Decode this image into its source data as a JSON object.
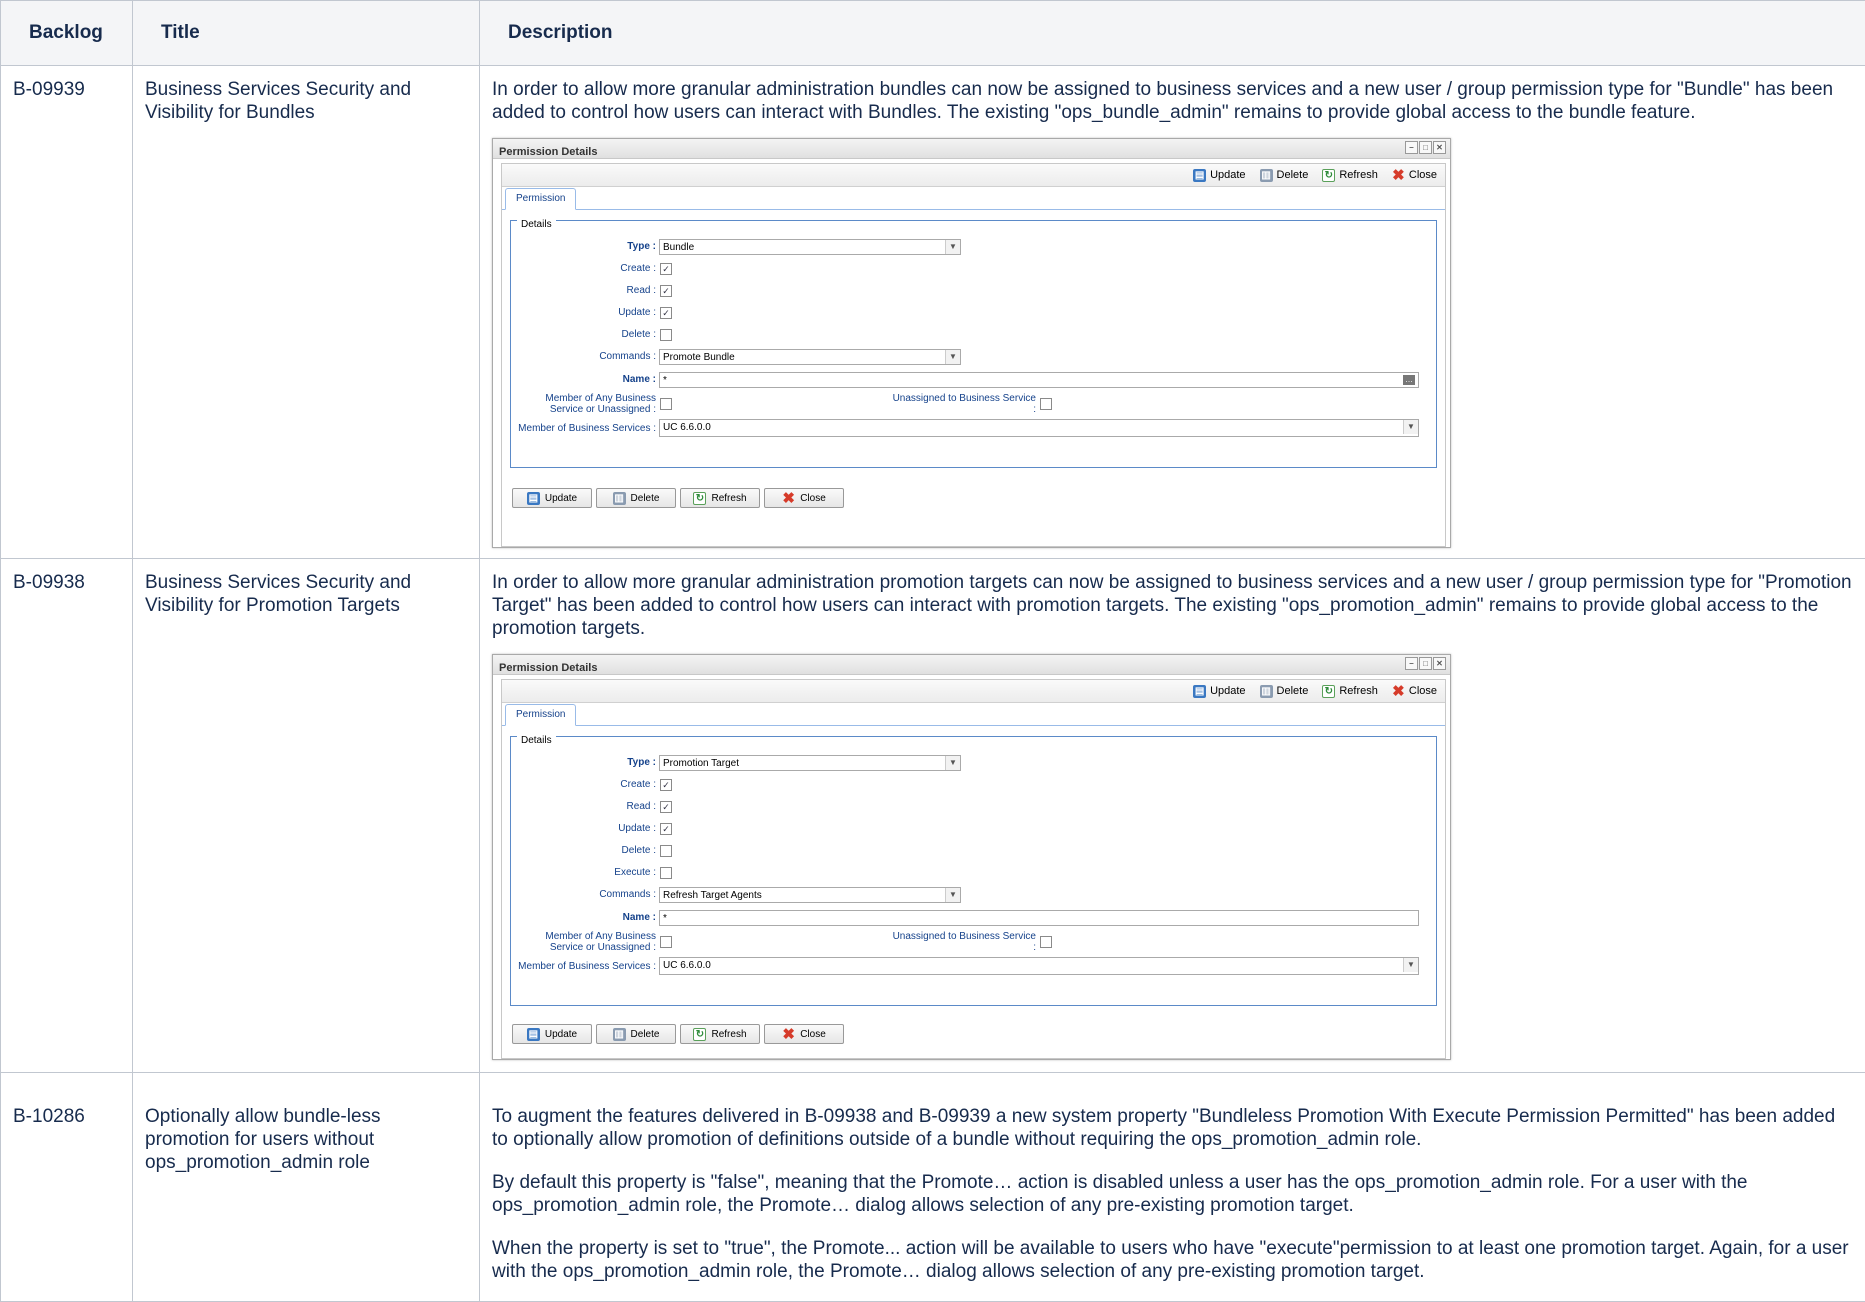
{
  "table": {
    "headers": [
      "Backlog",
      "Title",
      "Description"
    ],
    "rows": [
      {
        "backlog": "B-09939",
        "title": "Business Services Security and Visibility for Bundles",
        "description": [
          "In order to allow more granular administration bundles can now be assigned to business services and a new user / group permission type for \"Bundle\" has been added to control how users can interact with Bundles. The existing \"ops_bundle_admin\" remains to provide global access to the bundle feature."
        ],
        "dialog": {
          "title": "Permission Details",
          "toolbar": [
            "Update",
            "Delete",
            "Refresh",
            "Close"
          ],
          "tab": "Permission",
          "legend": "Details",
          "type_label": "Type :",
          "type_value": "Bundle",
          "create_label": "Create :",
          "read_label": "Read :",
          "update_label": "Update :",
          "delete_label": "Delete :",
          "commands_label": "Commands :",
          "commands_value": "Promote Bundle",
          "name_label": "Name :",
          "name_value": "*",
          "member_any_label": "Member of Any Business Service or Unassigned :",
          "unassigned_label": "Unassigned to Business Service :",
          "member_of_label": "Member of Business Services :",
          "member_of_value": "UC 6.6.0.0",
          "buttons": [
            "Update",
            "Delete",
            "Refresh",
            "Close"
          ]
        }
      },
      {
        "backlog": "B-09938",
        "title": "Business Services Security and Visibility for Promotion Targets",
        "description": [
          "In order to allow more granular administration promotion targets can now be assigned to business services and a new user / group permission type for \"Promotion Target\" has been added to control how users can interact with promotion targets. The existing \"ops_promotion_admin\" remains to provide global access to the promotion targets."
        ],
        "dialog": {
          "title": "Permission Details",
          "toolbar": [
            "Update",
            "Delete",
            "Refresh",
            "Close"
          ],
          "tab": "Permission",
          "legend": "Details",
          "type_label": "Type :",
          "type_value": "Promotion Target",
          "create_label": "Create :",
          "read_label": "Read :",
          "update_label": "Update :",
          "delete_label": "Delete :",
          "execute_label": "Execute :",
          "commands_label": "Commands :",
          "commands_value": "Refresh Target Agents",
          "name_label": "Name :",
          "name_value": "*",
          "member_any_label": "Member of Any Business Service or Unassigned :",
          "unassigned_label": "Unassigned to Business Service :",
          "member_of_label": "Member of Business Services :",
          "member_of_value": "UC 6.6.0.0",
          "buttons": [
            "Update",
            "Delete",
            "Refresh",
            "Close"
          ]
        }
      },
      {
        "backlog": "B-10286",
        "title": "Optionally allow bundle-less promotion for users without ops_promotion_admin role",
        "description": [
          "To augment the features delivered in B-09938 and B-09939 a new system property \"Bundleless Promotion With Execute Permission Permitted\" has been added to optionally allow promotion of definitions outside of a bundle without requiring the ops_promotion_admin role.",
          "By default this property is \"false\", meaning that the Promote… action is disabled unless a user has the ops_promotion_admin role. For a user with the ops_promotion_admin role, the Promote… dialog allows selection of any pre-existing promotion target.",
          "When the property is set to \"true\", the Promote... action will be available to users who have \"execute\"permission to at least one promotion target. Again, for a user with the ops_promotion_admin role, the Promote… dialog allows selection of any pre-existing promotion target."
        ]
      }
    ]
  }
}
